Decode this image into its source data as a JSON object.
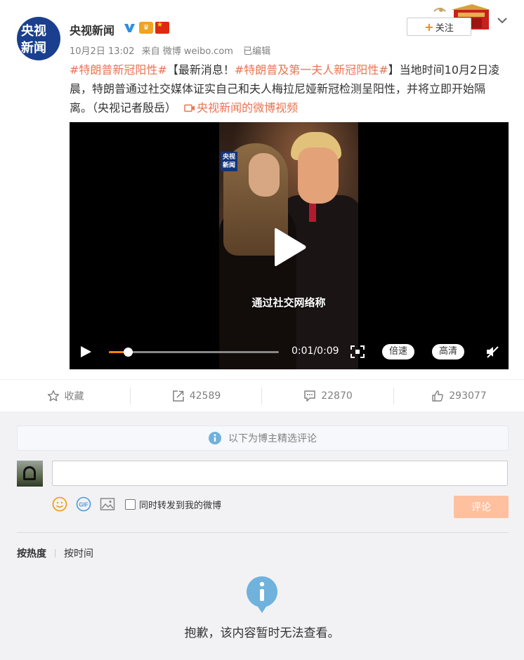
{
  "post": {
    "author": {
      "name": "央视新闻",
      "avatar_line1": "央视",
      "avatar_line2": "新闻",
      "verified_icon": "v-verified-icon",
      "badges": [
        "crown-badge-icon",
        "china-flag-icon"
      ]
    },
    "follow_label": "关注",
    "meta": {
      "date": "10月2日 13:02",
      "source": "来自 微博 weibo.com",
      "edited": "已编辑"
    },
    "text": {
      "tag1": "#特朗普新冠阳性#",
      "seg1": "【最新消息！",
      "tag2": "#特朗普及第一夫人新冠阳性#",
      "seg2": "】当地时间10月2日凌晨，特朗普通过社交媒体证实自己和夫人梅拉尼娅新冠检测呈阳性，并将立即开始隔离。（央视记者殷岳）",
      "video_link": "央视新闻的微博视频"
    }
  },
  "video": {
    "watermark_line1": "央视",
    "watermark_line2": "新闻",
    "caption": "通过社交网络称",
    "progress": 0.11,
    "time": "0:01/0:09",
    "speed_label": "倍速",
    "quality_label": "高清"
  },
  "actions": {
    "favorite_label": "收藏",
    "repost_count": "42589",
    "comment_count": "22870",
    "like_count": "293077"
  },
  "comments": {
    "notice": "以下为博主精选评论",
    "input_placeholder": "",
    "forward_checkbox_label": "同时转发到我的微博",
    "submit_label": "评论",
    "sort_hot": "按热度",
    "sort_time": "按时间",
    "empty_message": "抱歉，该内容暂时无法查看。"
  },
  "colors": {
    "accent": "#eb7350",
    "follow_plus": "#ff8200",
    "progress": "#ff8200",
    "submit_disabled": "#ffc09f",
    "info_blue": "#6fb2dc"
  }
}
